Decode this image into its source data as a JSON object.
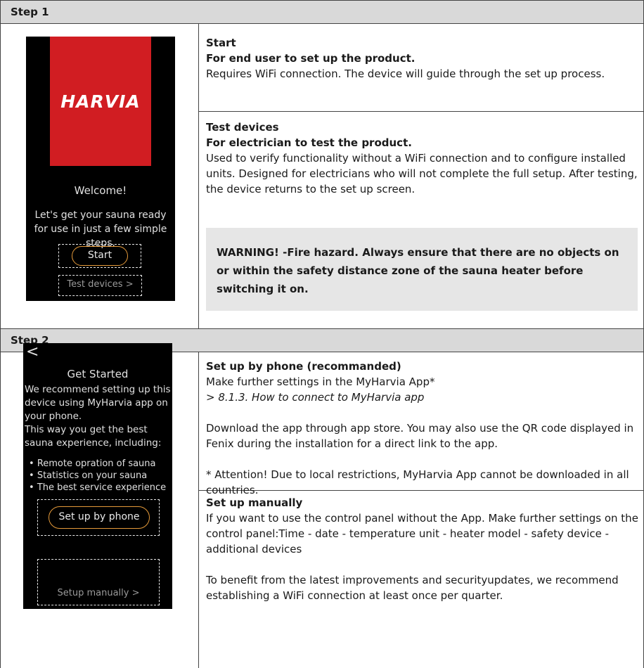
{
  "step1": {
    "header": "Step 1",
    "phone": {
      "logo": "HARVIA",
      "welcome": "Welcome!",
      "intro": "Let's get your sauna ready for use in just a few simple steps.",
      "start_button": "Start",
      "test_link": "Test devices >"
    },
    "start": {
      "title": "Start",
      "subtitle": "For end user to set up the product.",
      "body": "Requires WiFi connection. The device will guide through the set up process."
    },
    "test": {
      "title": "Test devices",
      "subtitle": "For electrician to test the product.",
      "body": "Used to verify functionality without a WiFi connection and to configure installed units. Designed for electricians who will not complete the full setup. After testing, the device returns to the set up screen."
    },
    "warning": "WARNING! -Fire hazard. Always ensure that there are no objects on or within the safety distance zone of the sauna heater before switching it on."
  },
  "step2": {
    "header": "Step 2",
    "phone": {
      "back": "<",
      "title": "Get Started",
      "intro": "We recommend setting up this device using MyHarvia app on your phone.",
      "intro2": "This way you get the best sauna experience, including:",
      "bullets": [
        "Remote opration of sauna",
        "Statistics on your sauna",
        "The best service experience"
      ],
      "phone_button": "Set up by phone",
      "manual_link": "Setup manually >"
    },
    "phone_setup": {
      "title": "Set up by phone (recommanded)",
      "line1": "Make further settings in the MyHarvia App*",
      "ref": "> 8.1.3. How to connect to MyHarvia app",
      "download": "Download the app through app store. You may also use the QR code displayed in Fenix during the installation for a direct link to the app.",
      "attention": "* Attention! Due to local restrictions, MyHarvia App cannot be downloaded in all countries."
    },
    "manual_setup": {
      "title": "Set up manually",
      "body": "If you want to use the control panel without the App. Make further settings on the control panel:Time - date - temperature unit - heater model - safety device - additional devices",
      "updates": "To benefit from the latest improvements and securityupdates, we recommend establishing a WiFi connection at least once per quarter."
    }
  }
}
